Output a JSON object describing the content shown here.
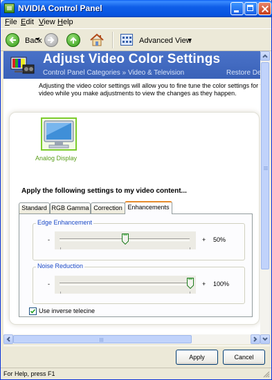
{
  "window": {
    "title": "NVIDIA Control Panel"
  },
  "menu": [
    {
      "mnemonic": "F",
      "rest": "ile"
    },
    {
      "mnemonic": "E",
      "rest": "dit"
    },
    {
      "mnemonic": "V",
      "rest": "iew"
    },
    {
      "mnemonic": "H",
      "rest": "elp"
    }
  ],
  "toolbar": {
    "back_label": "Back",
    "view_label": "Advanced View"
  },
  "header": {
    "title": "Adjust Video Color Settings",
    "breadcrumb": "Control Panel Categories  »  Video & Television",
    "restore": "Restore De"
  },
  "description": {
    "line1": "Adjusting the video color settings will allow you to fine tune the color settings for vide",
    "line2": "video while you make adjustments to view the changes as they happen."
  },
  "display": {
    "label": "Analog Display"
  },
  "apply_heading": "Apply the following settings to my video content...",
  "tabs": [
    {
      "label": "Standard"
    },
    {
      "label": "RGB Gamma"
    },
    {
      "label": "Correction"
    },
    {
      "label": "Enhancements"
    }
  ],
  "active_tab": "Enhancements",
  "edge_enhancement": {
    "label": "Edge Enhancement",
    "value": 50,
    "value_text": "50%",
    "minus": "-",
    "plus": "+"
  },
  "noise_reduction": {
    "label": "Noise Reduction",
    "value": 100,
    "value_text": "100%",
    "minus": "-",
    "plus": "+"
  },
  "inverse_telecine": {
    "label": "Use inverse telecine",
    "checked": true
  },
  "buttons": {
    "apply": "Apply",
    "cancel": "Cancel"
  },
  "status": {
    "text": "For Help, press F1"
  },
  "colors": {
    "banner": "#3a62b8",
    "title_bar": "#0653e0",
    "accent_tab": "#e68b2c",
    "group_label": "#1a49c6",
    "display_label": "#5a9e1a"
  }
}
